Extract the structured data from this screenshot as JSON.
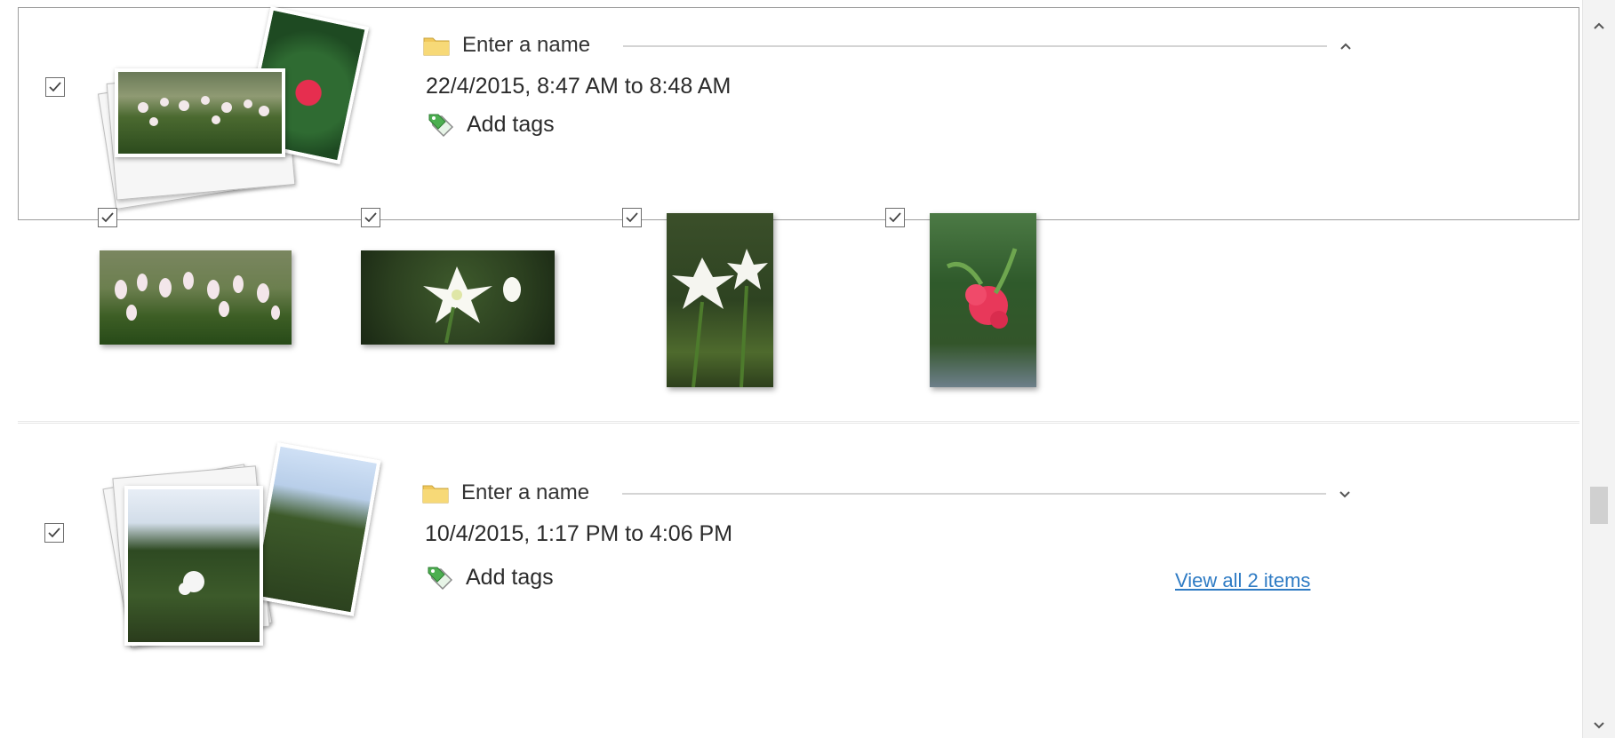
{
  "groups": [
    {
      "name_placeholder": "Enter a name",
      "date_range": "22/4/2015, 8:47 AM to 8:48 AM",
      "tags_label": "Add tags",
      "checked": true,
      "expanded": true,
      "items": [
        {
          "checked": true,
          "subject": "pink-white flowering shrub",
          "orientation": "landscape"
        },
        {
          "checked": true,
          "subject": "white lily closeup",
          "orientation": "landscape"
        },
        {
          "checked": true,
          "subject": "white lilies on stems",
          "orientation": "portrait"
        },
        {
          "checked": true,
          "subject": "red flower in greenery",
          "orientation": "portrait"
        }
      ]
    },
    {
      "name_placeholder": "Enter a name",
      "date_range": "10/4/2015, 1:17 PM to 4:06 PM",
      "tags_label": "Add tags",
      "view_all_label": "View all 2 items",
      "checked": true,
      "expanded": false
    }
  ],
  "icons": {
    "folder": "folder-icon",
    "tag": "tag-icon",
    "collapse": "chevron-up-icon",
    "expand": "chevron-down-icon",
    "scroll_up": "scroll-up-arrow-icon",
    "scroll_down": "scroll-down-arrow-icon"
  },
  "colors": {
    "link": "#2e7bc4",
    "selected_border": "#9d9d9d",
    "folder": "#f0c75a",
    "tag_green": "#4caf50"
  }
}
